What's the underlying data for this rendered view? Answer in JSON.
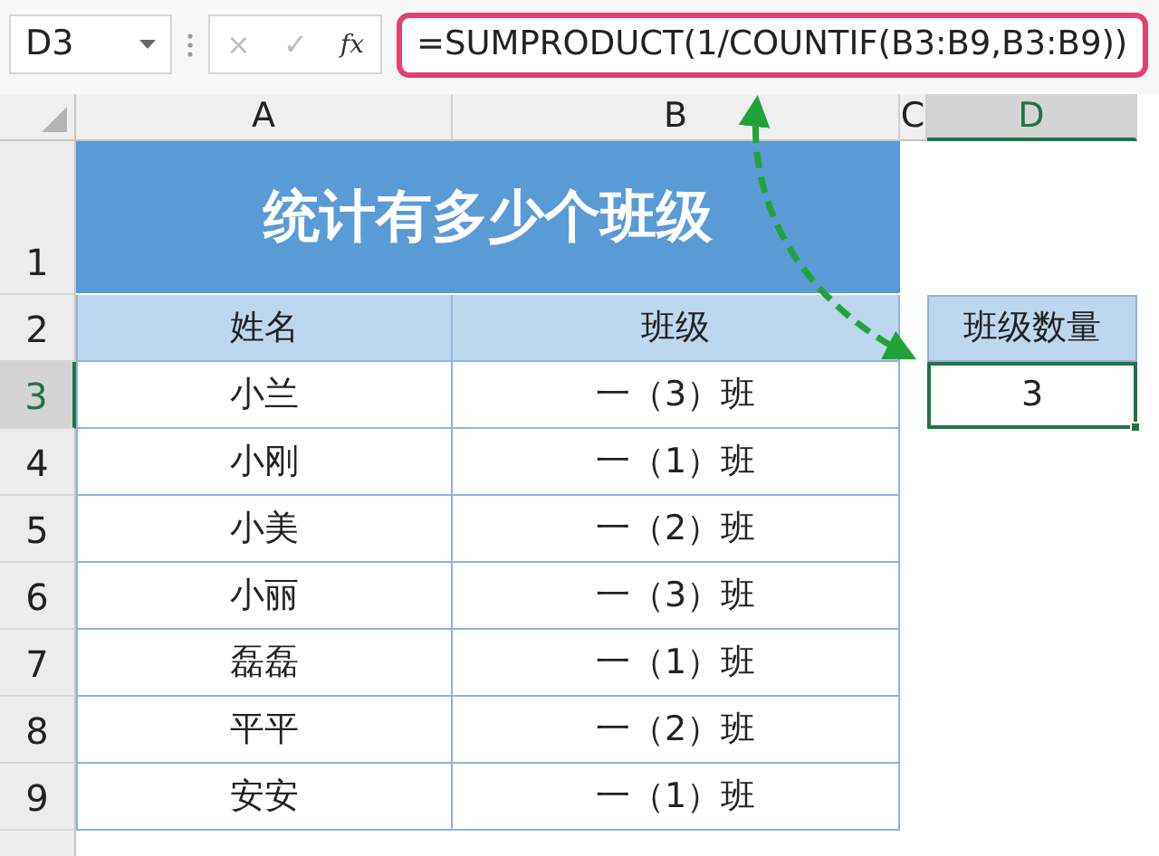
{
  "name_box": {
    "value": "D3"
  },
  "formula_buttons": [
    {
      "label": "×",
      "disabled": true
    },
    {
      "label": "✓",
      "disabled": true
    },
    {
      "label": "fx",
      "disabled": false
    }
  ],
  "formula": {
    "text": "=SUMPRODUCT(1/COUNTIF(B3:B9,B3:B9))",
    "highlighted": true
  },
  "column_headers": [
    {
      "label": "A",
      "selected": false
    },
    {
      "label": "B",
      "selected": false
    },
    {
      "label": "C",
      "selected": false
    },
    {
      "label": "D",
      "selected": true
    }
  ],
  "row_headers": [
    {
      "label": "1",
      "selected": false
    },
    {
      "label": "2",
      "selected": false
    },
    {
      "label": "3",
      "selected": true
    },
    {
      "label": "4",
      "selected": false
    },
    {
      "label": "5",
      "selected": false
    },
    {
      "label": "6",
      "selected": false
    },
    {
      "label": "7",
      "selected": false
    },
    {
      "label": "8",
      "selected": false
    },
    {
      "label": "9",
      "selected": false
    }
  ],
  "title": "统计有多少个班级",
  "table": {
    "columns": [
      "姓名",
      "班级"
    ],
    "rows": [
      [
        "小兰",
        "一（3）班"
      ],
      [
        "小刚",
        "一（1）班"
      ],
      [
        "小美",
        "一（2）班"
      ],
      [
        "小丽",
        "一（3）班"
      ],
      [
        "磊磊",
        "一（1）班"
      ],
      [
        "平平",
        "一（2）班"
      ],
      [
        "安安",
        "一（1）班"
      ]
    ]
  },
  "summary": {
    "header": "班级数量",
    "value": "3",
    "selected": true
  }
}
